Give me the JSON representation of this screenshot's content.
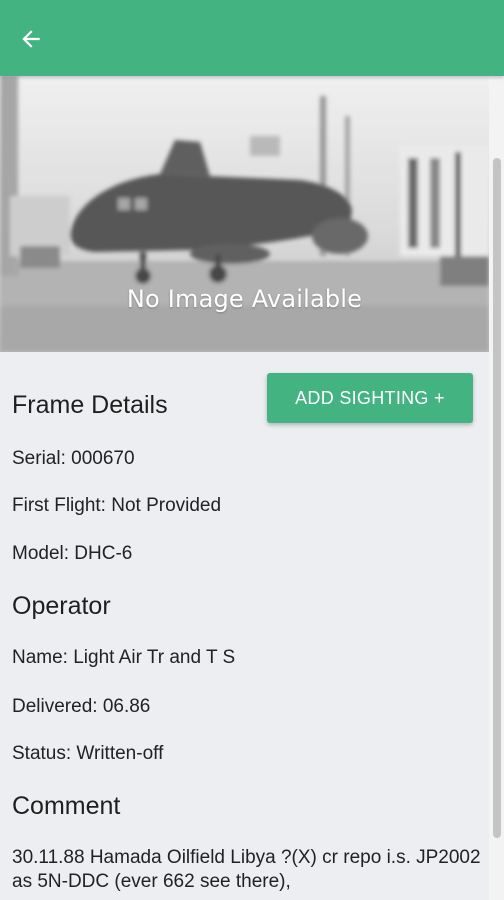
{
  "header": {
    "back_icon": "arrow-left-icon",
    "accent_color": "#43b382"
  },
  "photo": {
    "overlay_text": "No Image Available"
  },
  "actions": {
    "add_sighting_label": "ADD SIGHTING +"
  },
  "frame_details": {
    "title": "Frame Details",
    "serial": "Serial: 000670",
    "first_flight": "First Flight: Not Provided",
    "model": "Model: DHC-6"
  },
  "operator": {
    "title": "Operator",
    "name": "Name: Light Air Tr and T S",
    "delivered": "Delivered: 06.86",
    "status": "Status: Written-off"
  },
  "comment": {
    "title": "Comment",
    "text": "30.11.88 Hamada Oilfield Libya ?(X) cr repo i.s. JP2002 as 5N-DDC (ever 662 see there),"
  }
}
